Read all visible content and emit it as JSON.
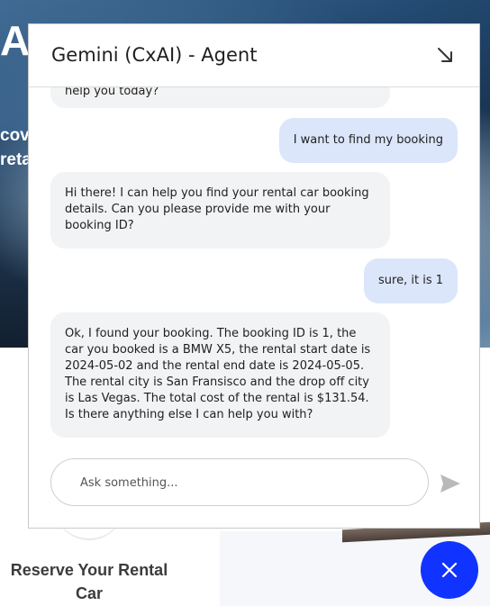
{
  "background": {
    "hero_title": "AI",
    "hero_line1": "cove",
    "hero_line2": "reta",
    "card_title": "Reserve Your Rental Car"
  },
  "chat": {
    "title": "Gemini (CxAI) - Agent",
    "messages": [
      {
        "role": "bot",
        "text": "help you today?"
      },
      {
        "role": "user",
        "text": "I want to find my booking"
      },
      {
        "role": "bot",
        "text": "Hi there! I can help you find your rental car booking details. Can you please provide me with your booking ID?"
      },
      {
        "role": "user",
        "text": "sure, it is 1"
      },
      {
        "role": "bot",
        "text": "Ok, I found your booking. The booking ID is 1, the car you booked is a BMW X5, the rental start date is 2024-05-02 and the rental end date is 2024-05-05. The rental city is San Fransisco and the drop off city is Las Vegas. The total cost of the rental is $131.54. Is there anything else I can help you with?"
      }
    ],
    "input_placeholder": "Ask something...",
    "input_value": ""
  },
  "icons": {
    "minimize": "arrow-down-right-icon",
    "send": "send-icon",
    "close": "close-icon"
  },
  "colors": {
    "accent": "#1133ff",
    "user_bubble": "#dbe6fb",
    "bot_bubble": "#f1f3f4"
  }
}
